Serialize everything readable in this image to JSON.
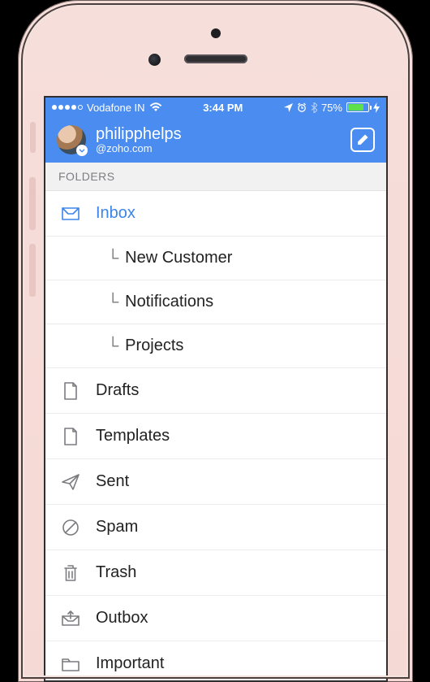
{
  "status": {
    "carrier": "Vodafone IN",
    "time": "3:44 PM",
    "battery_pct": "75%"
  },
  "account": {
    "name": "philipphelps",
    "domain": "@zoho.com"
  },
  "sections": {
    "folders_label": "FOLDERS"
  },
  "folders": [
    {
      "id": "inbox",
      "label": "Inbox",
      "icon": "inbox",
      "active": true,
      "children": [
        {
          "id": "new-customer",
          "label": "New Customer"
        },
        {
          "id": "notifications",
          "label": "Notifications"
        },
        {
          "id": "projects",
          "label": "Projects"
        }
      ]
    },
    {
      "id": "drafts",
      "label": "Drafts",
      "icon": "drafts"
    },
    {
      "id": "templates",
      "label": "Templates",
      "icon": "templates"
    },
    {
      "id": "sent",
      "label": "Sent",
      "icon": "sent"
    },
    {
      "id": "spam",
      "label": "Spam",
      "icon": "spam"
    },
    {
      "id": "trash",
      "label": "Trash",
      "icon": "trash"
    },
    {
      "id": "outbox",
      "label": "Outbox",
      "icon": "outbox"
    },
    {
      "id": "important",
      "label": "Important",
      "icon": "folder"
    }
  ],
  "icons": {
    "location": "➤",
    "alarm": "⏰",
    "bluetooth": "ᚼ",
    "charging": "⚡",
    "check": "✓",
    "pencil": "✎"
  }
}
